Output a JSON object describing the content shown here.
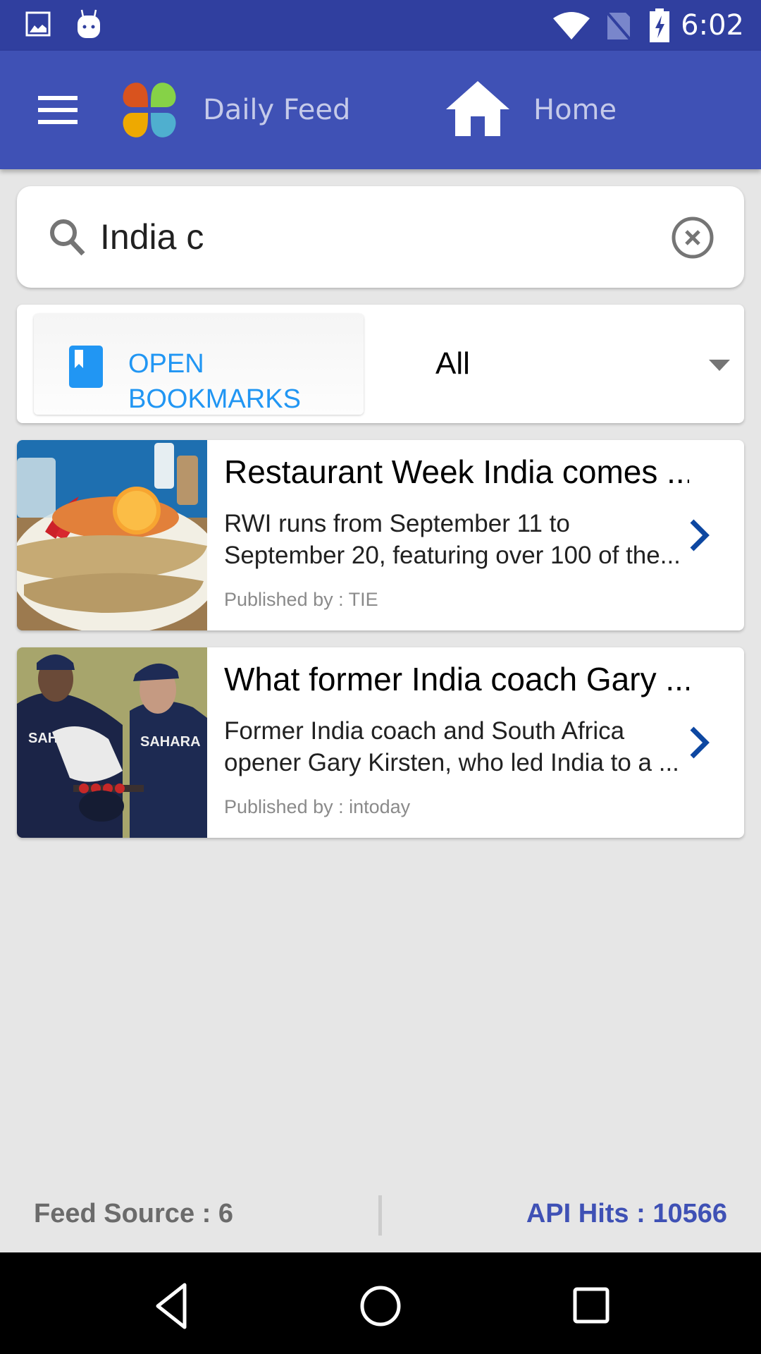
{
  "status_bar": {
    "time": "6:02",
    "left_icons": [
      "image-notification-icon",
      "android-notification-icon"
    ],
    "right_icons": [
      "wifi-icon",
      "no-sim-icon",
      "battery-charging-icon"
    ]
  },
  "app_bar": {
    "menu_icon": "hamburger-menu-icon",
    "logo_icon": "clover-logo-icon",
    "app_title": "Daily Feed",
    "home_icon": "home-icon",
    "section_title": "Home"
  },
  "search": {
    "icon": "search-icon",
    "value": "India c",
    "clear_icon": "clear-circle-icon"
  },
  "filter": {
    "bookmarks_label": "OPEN BOOKMARKS",
    "bookmarks_icon": "bookmark-icon",
    "selected": "All",
    "dropdown_icon": "dropdown-arrow-icon"
  },
  "articles": [
    {
      "title": "Restaurant Week India comes ...",
      "description": "RWI runs from September 11 to September 20, featuring over 100 of the...",
      "description_lines": [
        "RWI runs from September 11 to",
        "September 20, featuring over 100 of the..."
      ],
      "publisher": "Published by : TIE",
      "thumbnail": "food-plate-photo"
    },
    {
      "title": "What former India coach Gary ...",
      "description": "Former India coach and South Africa opener Gary Kirsten, who led India to a ...",
      "description_lines": [
        "Former India coach and South Africa",
        "opener Gary Kirsten, who led India to a ..."
      ],
      "publisher": "Published by : intoday",
      "thumbnail": "cricket-players-photo"
    }
  ],
  "footer": {
    "feed_source": "Feed Source : 6",
    "api_hits": "API Hits : 10566"
  },
  "nav_bar": {
    "buttons": [
      "back",
      "home",
      "recents"
    ]
  },
  "colors": {
    "status_bar": "#303f9f",
    "app_bar": "#3f51b5",
    "accent_blue": "#2196f3",
    "chevron": "#0d47a1",
    "api_hits": "#3f51b5"
  }
}
